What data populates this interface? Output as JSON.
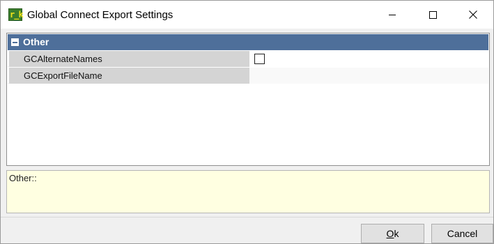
{
  "window": {
    "title": "Global Connect Export Settings",
    "icon": "app-icon",
    "icon_glyph": "r_k",
    "controls": [
      "minimize-icon",
      "maximize-icon",
      "close-icon"
    ]
  },
  "property_grid": {
    "category": "Other",
    "properties": [
      {
        "name": "GCAlternateNames",
        "type": "checkbox",
        "checked": false
      },
      {
        "name": "GCExportFileName",
        "type": "text",
        "value": ""
      }
    ]
  },
  "description": {
    "text": "Other::"
  },
  "buttons": {
    "ok_mnemonic": "O",
    "ok_rest": "k",
    "cancel_label": "Cancel"
  },
  "colors": {
    "category_header": "#4e6f9a",
    "description_bg": "#ffffe1",
    "property_name_bg": "#d4d4d4"
  }
}
